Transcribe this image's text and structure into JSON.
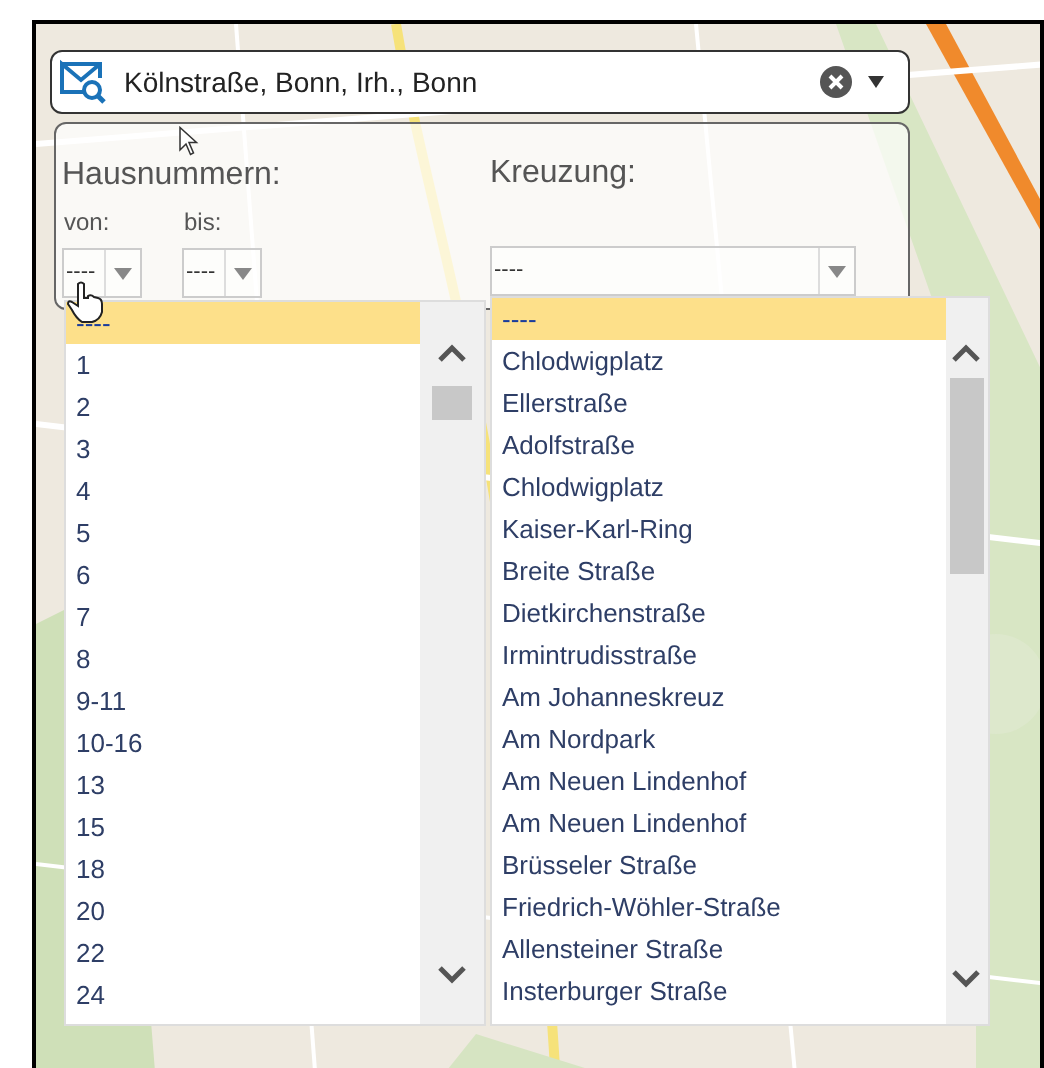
{
  "search": {
    "value": "Kölnstraße, Bonn, Irh., Bonn"
  },
  "house_numbers": {
    "label": "Hausnummern:",
    "from_label": "von:",
    "to_label": "bis:",
    "from_value": "----",
    "to_value": "----"
  },
  "crossing": {
    "label": "Kreuzung:",
    "value": "----"
  },
  "house_number_list": [
    {
      "label": "----",
      "selected": true
    },
    {
      "label": "1",
      "selected": false
    },
    {
      "label": "2",
      "selected": false
    },
    {
      "label": "3",
      "selected": false
    },
    {
      "label": "4",
      "selected": false
    },
    {
      "label": "5",
      "selected": false
    },
    {
      "label": "6",
      "selected": false
    },
    {
      "label": "7",
      "selected": false
    },
    {
      "label": "8",
      "selected": false
    },
    {
      "label": "9-11",
      "selected": false
    },
    {
      "label": "10-16",
      "selected": false
    },
    {
      "label": "13",
      "selected": false
    },
    {
      "label": "15",
      "selected": false
    },
    {
      "label": "18",
      "selected": false
    },
    {
      "label": "20",
      "selected": false
    },
    {
      "label": "22",
      "selected": false
    },
    {
      "label": "24",
      "selected": false
    }
  ],
  "crossing_list": [
    {
      "label": "----",
      "selected": true
    },
    {
      "label": "Chlodwigplatz",
      "selected": false
    },
    {
      "label": "Ellerstraße",
      "selected": false
    },
    {
      "label": "Adolfstraße",
      "selected": false
    },
    {
      "label": "Chlodwigplatz",
      "selected": false
    },
    {
      "label": "Kaiser-Karl-Ring",
      "selected": false
    },
    {
      "label": "Breite Straße",
      "selected": false
    },
    {
      "label": "Dietkirchenstraße",
      "selected": false
    },
    {
      "label": "Irmintrudisstraße",
      "selected": false
    },
    {
      "label": "Am Johanneskreuz",
      "selected": false
    },
    {
      "label": "Am Nordpark",
      "selected": false
    },
    {
      "label": "Am Neuen Lindenhof",
      "selected": false
    },
    {
      "label": "Am Neuen Lindenhof",
      "selected": false
    },
    {
      "label": "Brüsseler Straße",
      "selected": false
    },
    {
      "label": "Friedrich-Wöhler-Straße",
      "selected": false
    },
    {
      "label": "Allensteiner Straße",
      "selected": false
    },
    {
      "label": "Insterburger Straße",
      "selected": false
    }
  ]
}
